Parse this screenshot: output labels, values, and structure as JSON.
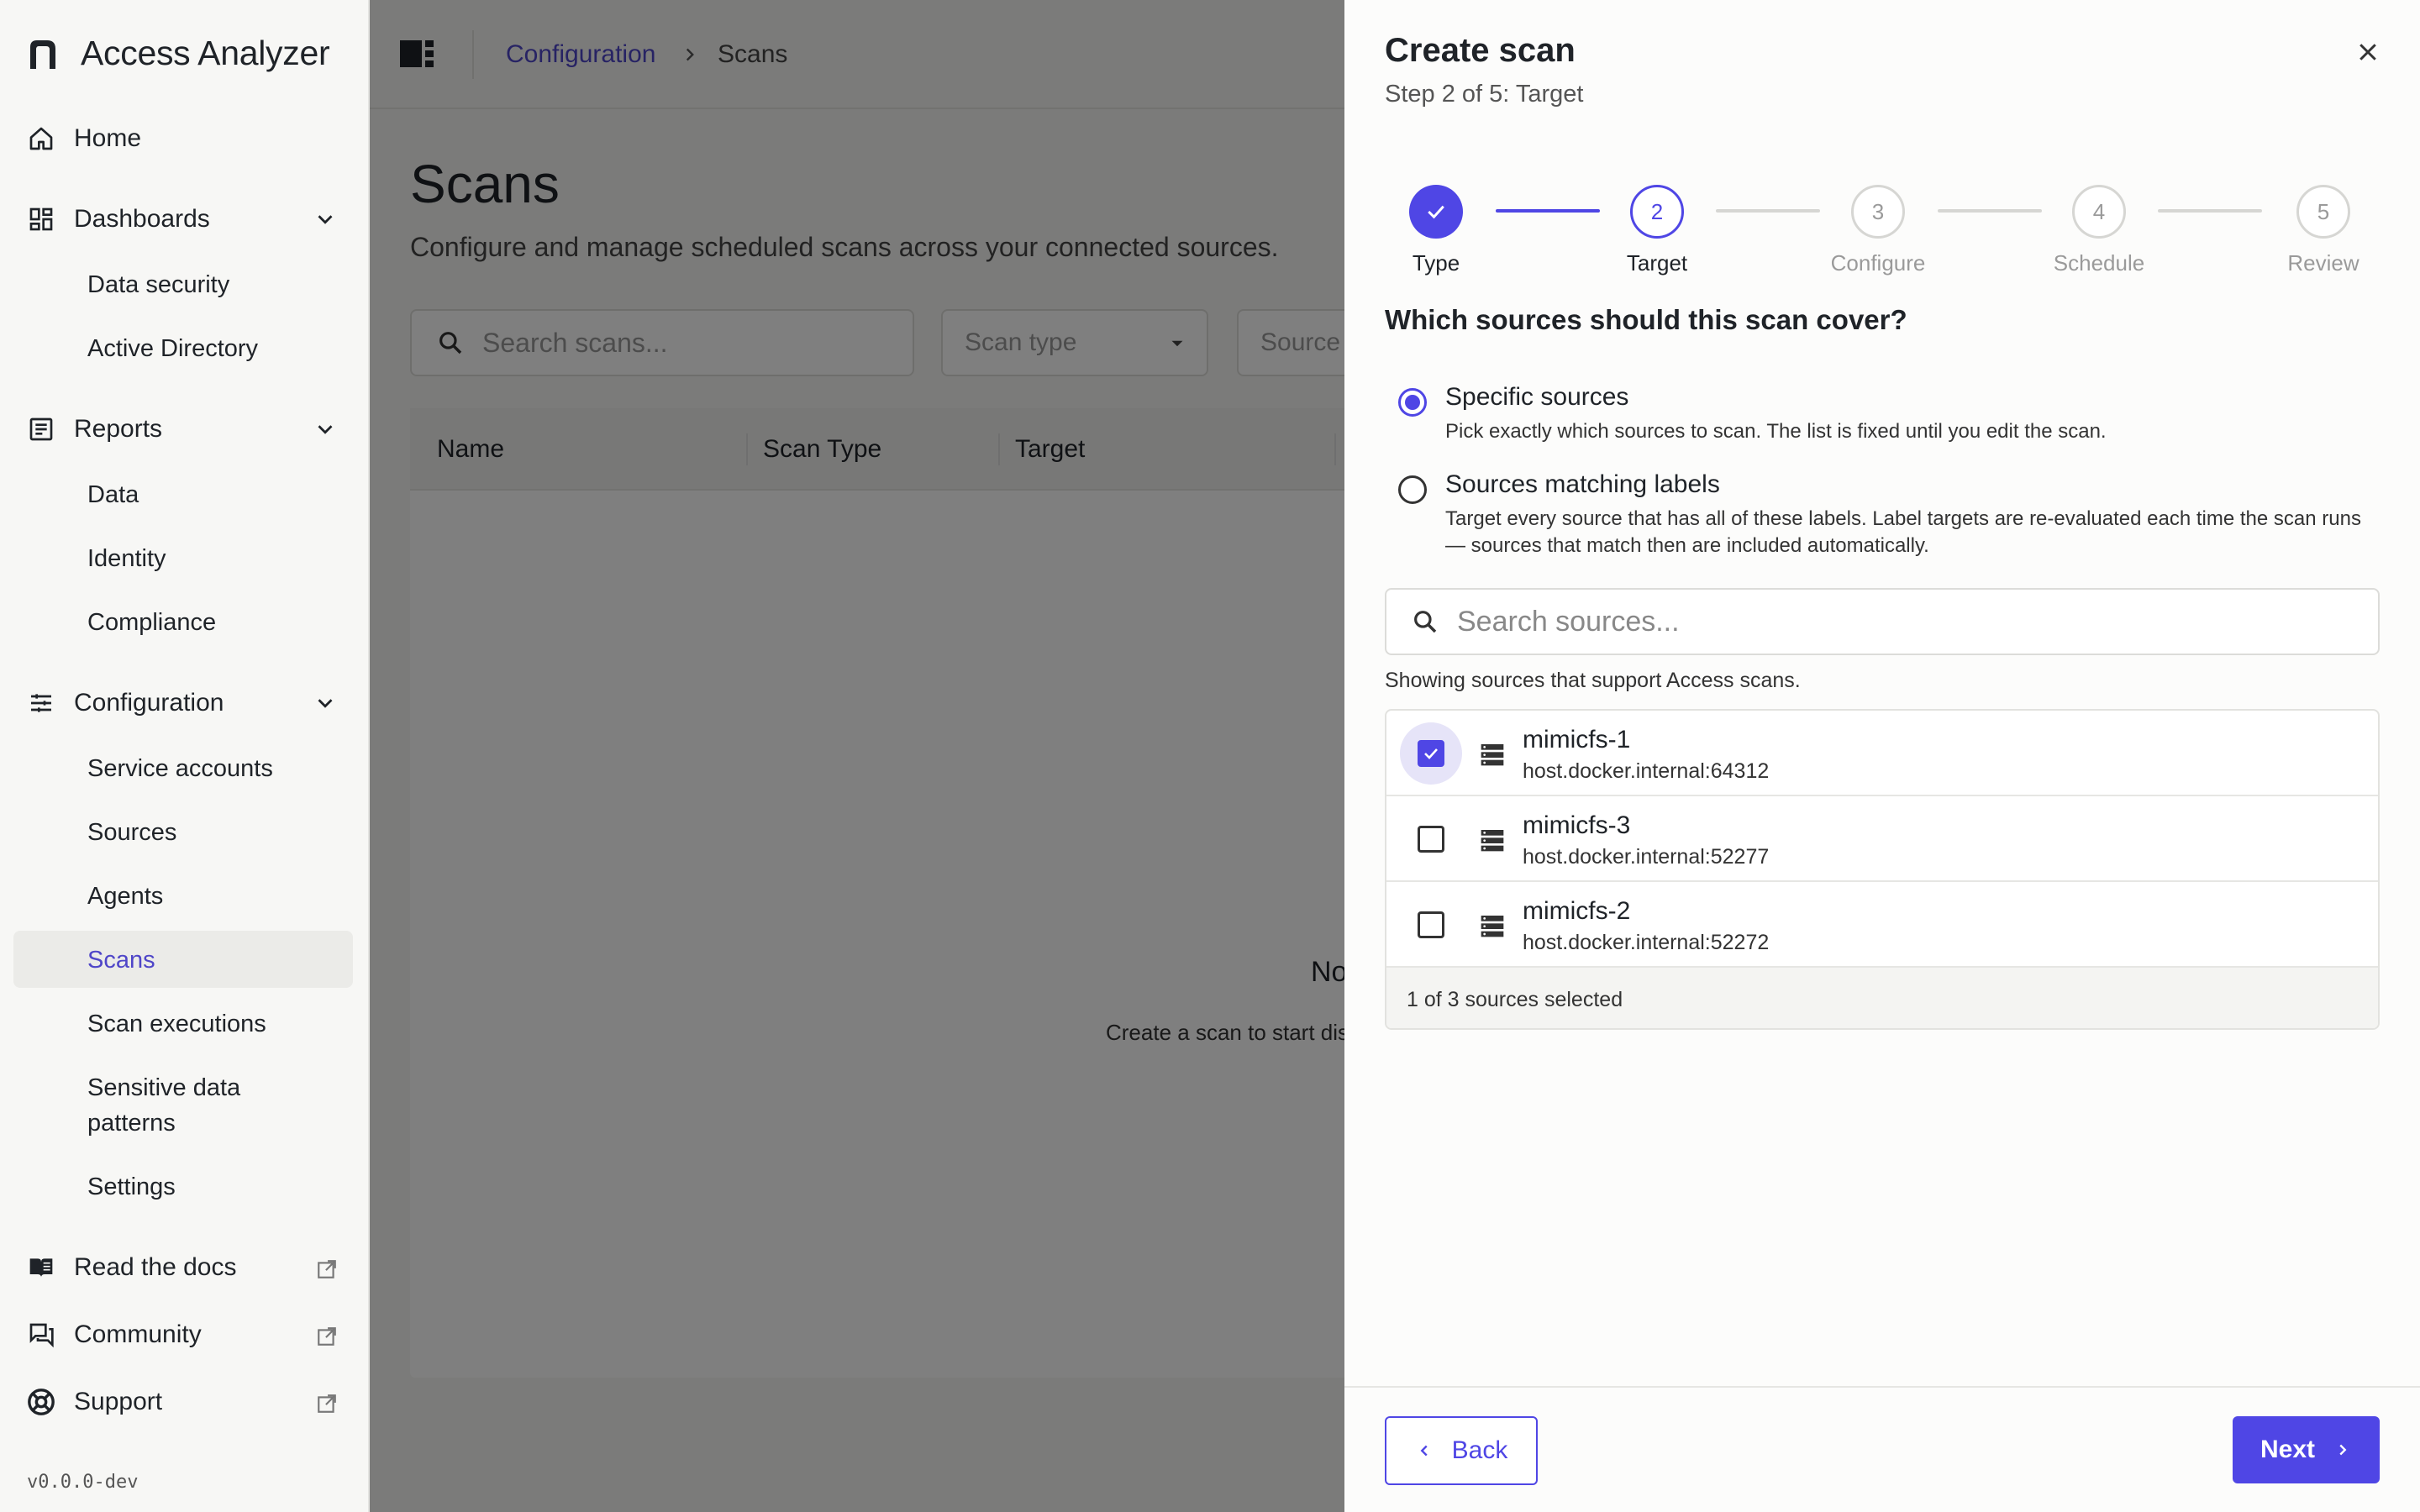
{
  "app": {
    "title": "Access Analyzer",
    "version": "v0.0.0-dev"
  },
  "sidebar": {
    "home": "Home",
    "dashboards": {
      "label": "Dashboards",
      "items": [
        "Data security",
        "Active Directory"
      ]
    },
    "reports": {
      "label": "Reports",
      "items": [
        "Data",
        "Identity",
        "Compliance"
      ]
    },
    "configuration": {
      "label": "Configuration",
      "items": [
        "Service accounts",
        "Sources",
        "Agents",
        "Scans",
        "Scan executions",
        "Sensitive data patterns",
        "Settings"
      ],
      "active": "Scans"
    },
    "links": [
      "Read the docs",
      "Community",
      "Support"
    ]
  },
  "breadcrumb": {
    "parent": "Configuration",
    "current": "Scans"
  },
  "page": {
    "title": "Scans",
    "subtitle": "Configure and manage scheduled scans across your connected sources.",
    "search_placeholder": "Search scans...",
    "scan_type_filter": "Scan type",
    "source_filter": "Source",
    "columns": [
      "Name",
      "Scan Type",
      "Target"
    ],
    "empty_title": "No",
    "empty_sub": "Create a scan to start dis"
  },
  "drawer": {
    "title": "Create scan",
    "subtitle": "Step 2 of 5: Target",
    "steps": [
      {
        "num": "1",
        "label": "Type",
        "state": "done"
      },
      {
        "num": "2",
        "label": "Target",
        "state": "current"
      },
      {
        "num": "3",
        "label": "Configure",
        "state": "todo"
      },
      {
        "num": "4",
        "label": "Schedule",
        "state": "todo"
      },
      {
        "num": "5",
        "label": "Review",
        "state": "todo"
      }
    ],
    "question": "Which sources should this scan cover?",
    "options": [
      {
        "title": "Specific sources",
        "desc": "Pick exactly which sources to scan. The list is fixed until you edit the scan.",
        "checked": true
      },
      {
        "title": "Sources matching labels",
        "desc": "Target every source that has all of these labels. Label targets are re-evaluated each time the scan runs — sources that match then are included automatically.",
        "checked": false
      }
    ],
    "search_placeholder": "Search sources...",
    "helper": "Showing sources that support Access scans.",
    "sources": [
      {
        "name": "mimicfs-1",
        "host": "host.docker.internal:64312",
        "selected": true
      },
      {
        "name": "mimicfs-3",
        "host": "host.docker.internal:52277",
        "selected": false
      },
      {
        "name": "mimicfs-2",
        "host": "host.docker.internal:52272",
        "selected": false
      }
    ],
    "selection_summary": "1 of 3 sources selected",
    "back_label": "Back",
    "next_label": "Next"
  },
  "colors": {
    "accent": "#4f46e5",
    "link": "#4f46c8"
  }
}
